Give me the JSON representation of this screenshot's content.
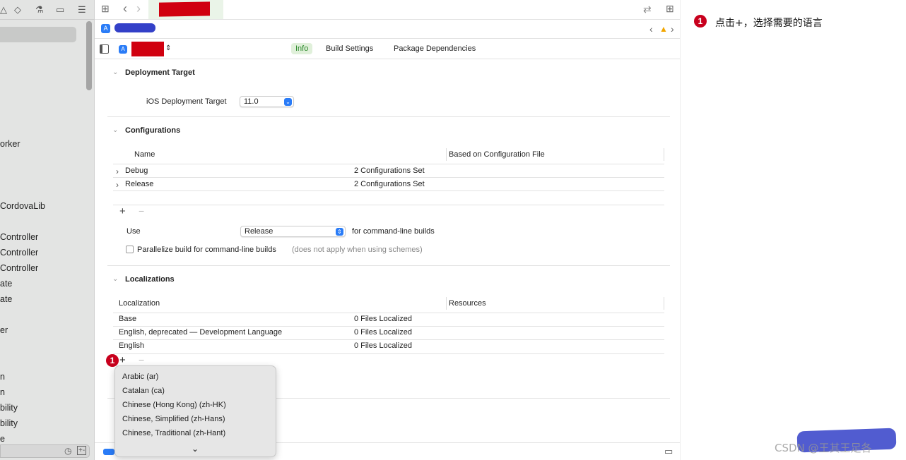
{
  "sidebar": {
    "items": [
      "orker",
      "CordovaLib",
      "Controller",
      "Controller",
      "Controller",
      "ate",
      "ate",
      "er",
      "n",
      "n",
      "bility",
      "bility",
      "e"
    ]
  },
  "toolbar": {
    "back": "‹",
    "forward": "›"
  },
  "tabs": [
    {
      "label": "Info",
      "selected": true
    },
    {
      "label": "Build Settings"
    },
    {
      "label": "Package Dependencies"
    }
  ],
  "deployment": {
    "title": "Deployment Target",
    "label": "iOS Deployment Target",
    "value": "11.0"
  },
  "configurations": {
    "title": "Configurations",
    "headers": [
      "Name",
      "Based on Configuration File"
    ],
    "rows": [
      {
        "name": "Debug",
        "file": "2 Configurations Set"
      },
      {
        "name": "Release",
        "file": "2 Configurations Set"
      }
    ],
    "use_label": "Use",
    "use_value": "Release",
    "use_suffix": "for command-line builds",
    "parallelize": "Parallelize build for command-line builds",
    "parallelize_note": "(does not apply when using schemes)"
  },
  "localizations": {
    "title": "Localizations",
    "headers": [
      "Localization",
      "Resources"
    ],
    "rows": [
      {
        "name": "Base",
        "res": "0 Files Localized"
      },
      {
        "name": "English, deprecated — Development Language",
        "res": "0 Files Localized"
      },
      {
        "name": "English",
        "res": "0 Files Localized"
      }
    ]
  },
  "menu": {
    "items": [
      "Arabic (ar)",
      "Catalan (ca)",
      "Chinese (Hong Kong) (zh-HK)",
      "Chinese, Simplified (zh-Hans)",
      "Chinese, Traditional (zh-Hant)"
    ]
  },
  "annotation": {
    "number": "1",
    "text": "点击+，选择需要的语言"
  },
  "watermark": "CSDN @王其王足各",
  "colors": {
    "accent": "#2a7cf7",
    "badge": "#c8001d",
    "redaction_red": "#d0000f",
    "redaction_blue": "#3340c8"
  }
}
